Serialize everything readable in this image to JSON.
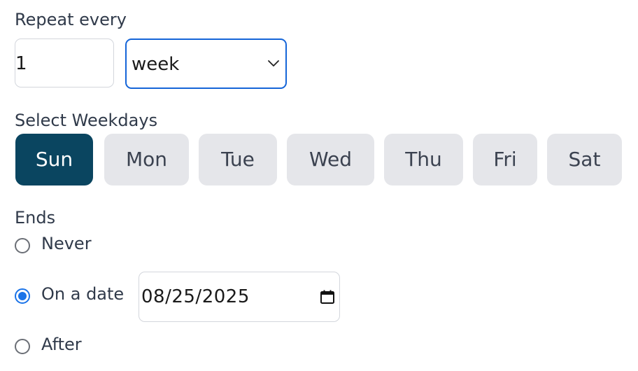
{
  "repeat": {
    "label": "Repeat every",
    "interval_value": "1",
    "unit_selected": "week"
  },
  "weekdays": {
    "label": "Select Weekdays",
    "days": [
      "Sun",
      "Mon",
      "Tue",
      "Wed",
      "Thu",
      "Fri",
      "Sat"
    ],
    "selected": "Sun"
  },
  "ends": {
    "label": "Ends",
    "options": [
      "Never",
      "On a date",
      "After"
    ],
    "selected": "On a date",
    "date_value": "08/25/2025"
  },
  "colors": {
    "accent": "#1565d8",
    "selected_day_bg": "#0a4560",
    "day_bg": "#e5e6ea"
  },
  "icons": {
    "select_arrow": "chevron-down-icon",
    "date_picker": "calendar-icon"
  }
}
